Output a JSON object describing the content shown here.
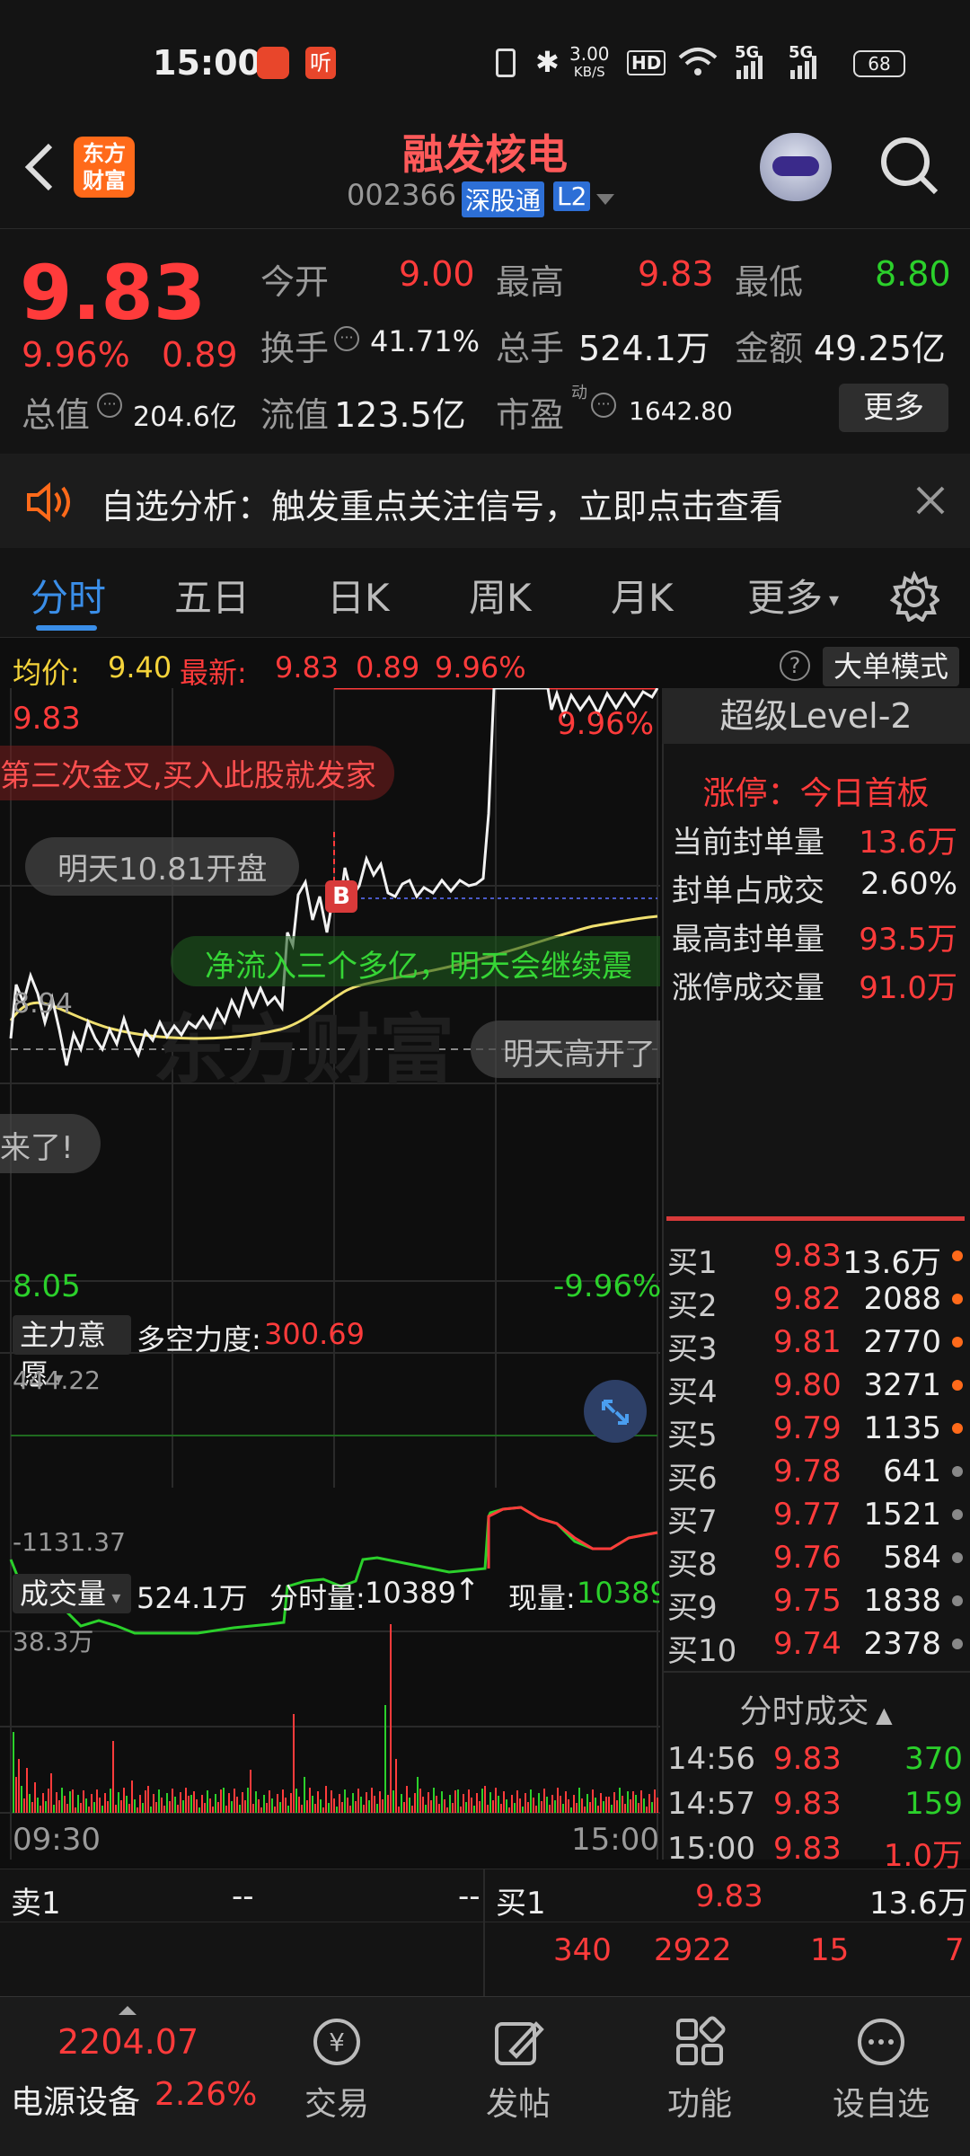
{
  "status": {
    "time": "15:00",
    "speed": "3.00",
    "speed_unit": "KB/S",
    "hd": "HD",
    "battery": "68",
    "net1": "5G",
    "net2": "5G"
  },
  "header": {
    "logo_line1": "东方",
    "logo_line2": "财富",
    "stock_name": "融发核电",
    "stock_code": "002366",
    "tag_sgt": "深股通",
    "tag_l2": "L2"
  },
  "quote": {
    "price": "9.83",
    "pct": "9.96%",
    "change": "0.89",
    "open_label": "今开",
    "open": "9.00",
    "high_label": "最高",
    "high": "9.83",
    "low_label": "最低",
    "low": "8.80",
    "turnover_label": "换手",
    "turnover": "41.71%",
    "volume_label": "总手",
    "volume": "524.1万",
    "amount_label": "金额",
    "amount": "49.25亿",
    "mcap_label": "总值",
    "mcap": "204.6亿",
    "float_label": "流值",
    "float": "123.5亿",
    "pe_label": "市盈",
    "pe_sup": "动",
    "pe": "1642.80",
    "more_btn": "更多"
  },
  "banner": {
    "text": "自选分析：触发重点关注信号，立即点击查看"
  },
  "tabs": [
    "分时",
    "五日",
    "日K",
    "周K",
    "月K",
    "更多"
  ],
  "chart": {
    "avg_label": "均价:",
    "avg": "9.40",
    "latest_label": "最新:",
    "latest": "9.83",
    "latest_chg": "0.89",
    "latest_pct": "9.96%",
    "mode_btn": "大单模式",
    "y_top": "9.83",
    "y_top_pct": "9.96%",
    "y_mid": "8.94",
    "y_bottom": "8.05",
    "y_bottom_pct": "-9.96%",
    "b_marker": "B",
    "danmu": [
      "第三次金叉,买入此股就发家",
      "明天10.81开盘",
      "净流入三个多亿，明天会继续震",
      "明天高开了",
      "来了!"
    ],
    "watermark": "东方财富",
    "ind_btn": "主力意愿",
    "ind_label": "多空力度:",
    "ind_value": "300.69",
    "ind_max": "444.22",
    "ind_min": "-1131.37",
    "vol_btn": "成交量",
    "vol_total": "524.1万",
    "vol_min_label": "分时量:",
    "vol_min": "10389",
    "vol_now_label": "现量:",
    "vol_now": "10389",
    "vol_max": "38.3万",
    "time_start": "09:30",
    "time_end": "15:00"
  },
  "level2": {
    "title": "超级Level-2",
    "limit_label": "涨停：今日首板",
    "rows": [
      {
        "label": "当前封单量",
        "value": "13.6万"
      },
      {
        "label": "封单占成交",
        "value": "2.60%"
      },
      {
        "label": "最高封单量",
        "value": "93.5万"
      },
      {
        "label": "涨停成交量",
        "value": "91.0万"
      }
    ]
  },
  "orderbook": [
    {
      "label": "买1",
      "price": "9.83",
      "vol": "13.6万"
    },
    {
      "label": "买2",
      "price": "9.82",
      "vol": "2088"
    },
    {
      "label": "买3",
      "price": "9.81",
      "vol": "2770"
    },
    {
      "label": "买4",
      "price": "9.80",
      "vol": "3271"
    },
    {
      "label": "买5",
      "price": "9.79",
      "vol": "1135"
    },
    {
      "label": "买6",
      "price": "9.78",
      "vol": "641"
    },
    {
      "label": "买7",
      "price": "9.77",
      "vol": "1521"
    },
    {
      "label": "买8",
      "price": "9.76",
      "vol": "584"
    },
    {
      "label": "买9",
      "price": "9.75",
      "vol": "1838"
    },
    {
      "label": "买10",
      "price": "9.74",
      "vol": "2378"
    }
  ],
  "ticks": {
    "title": "分时成交",
    "rows": [
      {
        "time": "14:56",
        "price": "9.83",
        "vol": "370"
      },
      {
        "time": "14:57",
        "price": "9.83",
        "vol": "159"
      },
      {
        "time": "15:00",
        "price": "9.83",
        "vol": "1.0万"
      }
    ]
  },
  "queue": {
    "sell_label": "卖1",
    "sell_price": "--",
    "sell_vol": "--",
    "buy_label": "买1",
    "buy_price": "9.83",
    "buy_vol": "13.6万",
    "buy_q": [
      "340",
      "2922",
      "15",
      "7"
    ]
  },
  "bottom": {
    "index_value": "2204.07",
    "index_name": "电源设备",
    "index_pct": "2.26%",
    "btn1": "交易",
    "btn2": "发帖",
    "btn3": "功能",
    "btn4": "设自选"
  }
}
